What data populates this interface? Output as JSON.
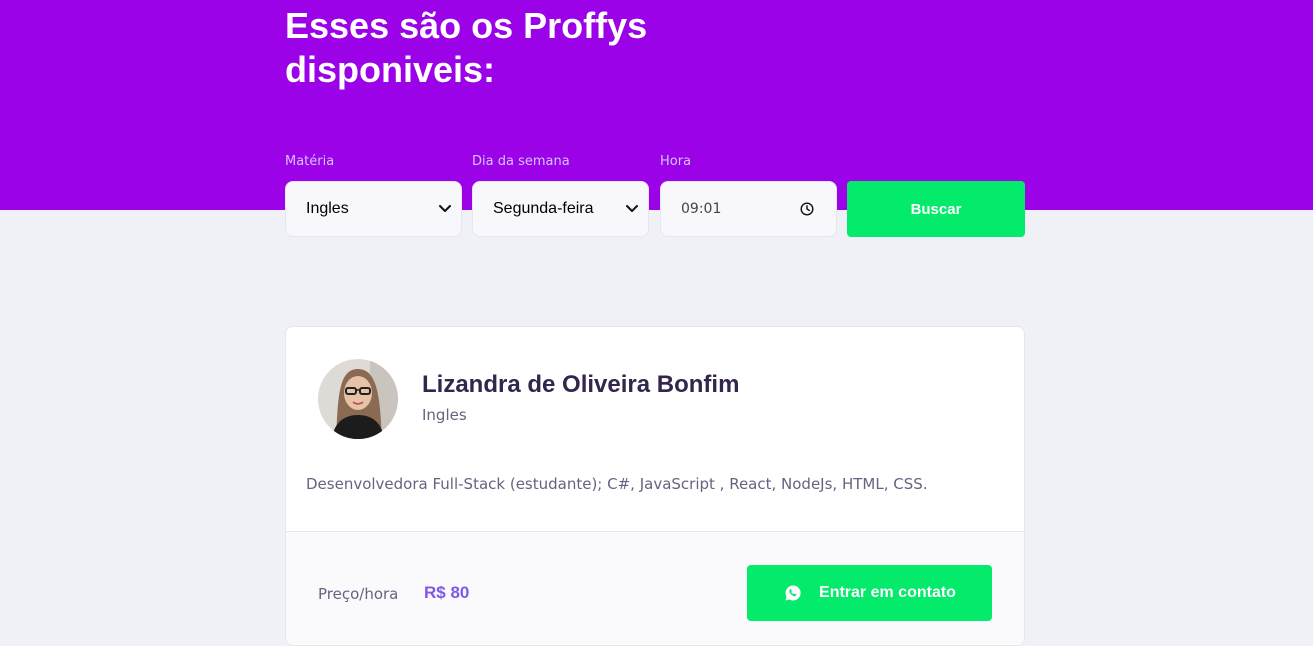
{
  "header": {
    "title": "Esses são os Proffys disponiveis:"
  },
  "filters": {
    "subject": {
      "label": "Matéria",
      "value": "Ingles"
    },
    "weekday": {
      "label": "Dia da semana",
      "value": "Segunda-feira"
    },
    "time": {
      "label": "Hora",
      "value": "09:01"
    },
    "search_label": "Buscar"
  },
  "teacher": {
    "name": "Lizandra de Oliveira Bonfim",
    "subject": "Ingles",
    "bio": "Desenvolvedora Full-Stack (estudante); C#, JavaScript , React, NodeJs, HTML, CSS.",
    "price_label": "Preço/hora",
    "price": "R$ 80",
    "contact_label": "Entrar em contato"
  },
  "icons": {
    "select": "chevron-down-icon",
    "time": "clock-icon",
    "contact": "whatsapp-icon"
  },
  "colors": {
    "primary": "#9b02e8",
    "accent_green": "#04ea6b",
    "background": "#f0f0f7",
    "title_dark": "#32264d",
    "text_muted": "#6a6180",
    "price": "#8257e5"
  }
}
